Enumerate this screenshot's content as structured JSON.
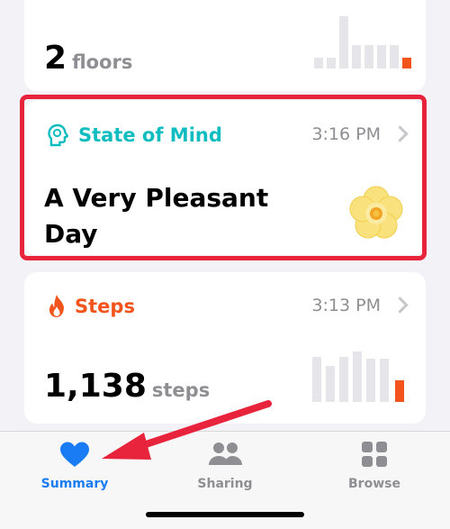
{
  "floors_card": {
    "value": "2",
    "unit": "floors",
    "bars": [
      0.22,
      0.22,
      1.0,
      0.45,
      0.45,
      0.45,
      0.45,
      0.22
    ]
  },
  "state_of_mind_card": {
    "title": "State of Mind",
    "time": "3:16 PM",
    "description": "A Very Pleasant Day",
    "accent_color": "#0fbcbf",
    "icon": "head-icon",
    "mood_icon": "flower-icon"
  },
  "steps_card": {
    "title": "Steps",
    "time": "3:13 PM",
    "value": "1,138",
    "unit": "steps",
    "accent_color": "#f2541b",
    "icon": "flame-icon",
    "bars": [
      0.9,
      0.7,
      0.9,
      1.0,
      0.85,
      0.85,
      0.4
    ]
  },
  "tabbar": {
    "tabs": [
      {
        "label": "Summary",
        "icon": "heart-icon",
        "selected": true
      },
      {
        "label": "Sharing",
        "icon": "people-icon",
        "selected": false
      },
      {
        "label": "Browse",
        "icon": "grid-icon",
        "selected": false
      }
    ]
  },
  "colors": {
    "highlight": "#e8243c",
    "tab_active": "#1a7cf5",
    "tab_inactive": "#8e8e93",
    "bar_current": "#f2541b"
  }
}
